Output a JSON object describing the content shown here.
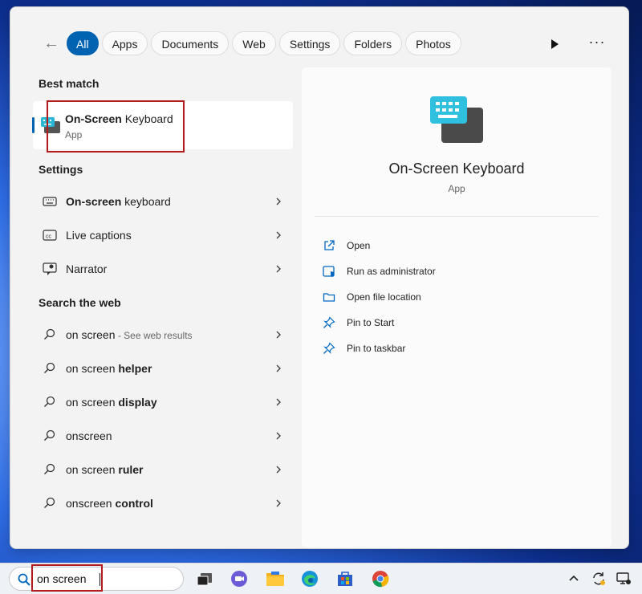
{
  "filters": [
    "All",
    "Apps",
    "Documents",
    "Web",
    "Settings",
    "Folders",
    "Photos"
  ],
  "sections": {
    "best_match": "Best match",
    "settings": "Settings",
    "search_web": "Search the web"
  },
  "best_match": {
    "title_bold": "On-Screen",
    "title_rest": " Keyboard",
    "subtitle": "App"
  },
  "settings_items": [
    {
      "bold": "On-screen",
      "rest": " keyboard",
      "icon": "keyboard-icon"
    },
    {
      "bold": "",
      "rest": "Live captions",
      "icon": "captions-icon"
    },
    {
      "bold": "",
      "rest": "Narrator",
      "icon": "narrator-icon"
    }
  ],
  "web_items": [
    {
      "pre": "on screen",
      "bold": "",
      "hint": " - See web results"
    },
    {
      "pre": "on screen ",
      "bold": "helper",
      "hint": ""
    },
    {
      "pre": "on screen ",
      "bold": "display",
      "hint": ""
    },
    {
      "pre": "onscreen",
      "bold": "",
      "hint": ""
    },
    {
      "pre": "on screen ",
      "bold": "ruler",
      "hint": ""
    },
    {
      "pre": "onscreen ",
      "bold": "control",
      "hint": ""
    }
  ],
  "details": {
    "title": "On-Screen Keyboard",
    "subtitle": "App",
    "actions": [
      {
        "label": "Open",
        "icon": "open-icon"
      },
      {
        "label": "Run as administrator",
        "icon": "admin-shield-icon"
      },
      {
        "label": "Open file location",
        "icon": "folder-icon"
      },
      {
        "label": "Pin to Start",
        "icon": "pin-icon"
      },
      {
        "label": "Pin to taskbar",
        "icon": "pin-icon"
      }
    ]
  },
  "taskbar": {
    "search_value": "on screen"
  },
  "colors": {
    "accent": "#0063b1",
    "highlight": "#b21b1b"
  }
}
